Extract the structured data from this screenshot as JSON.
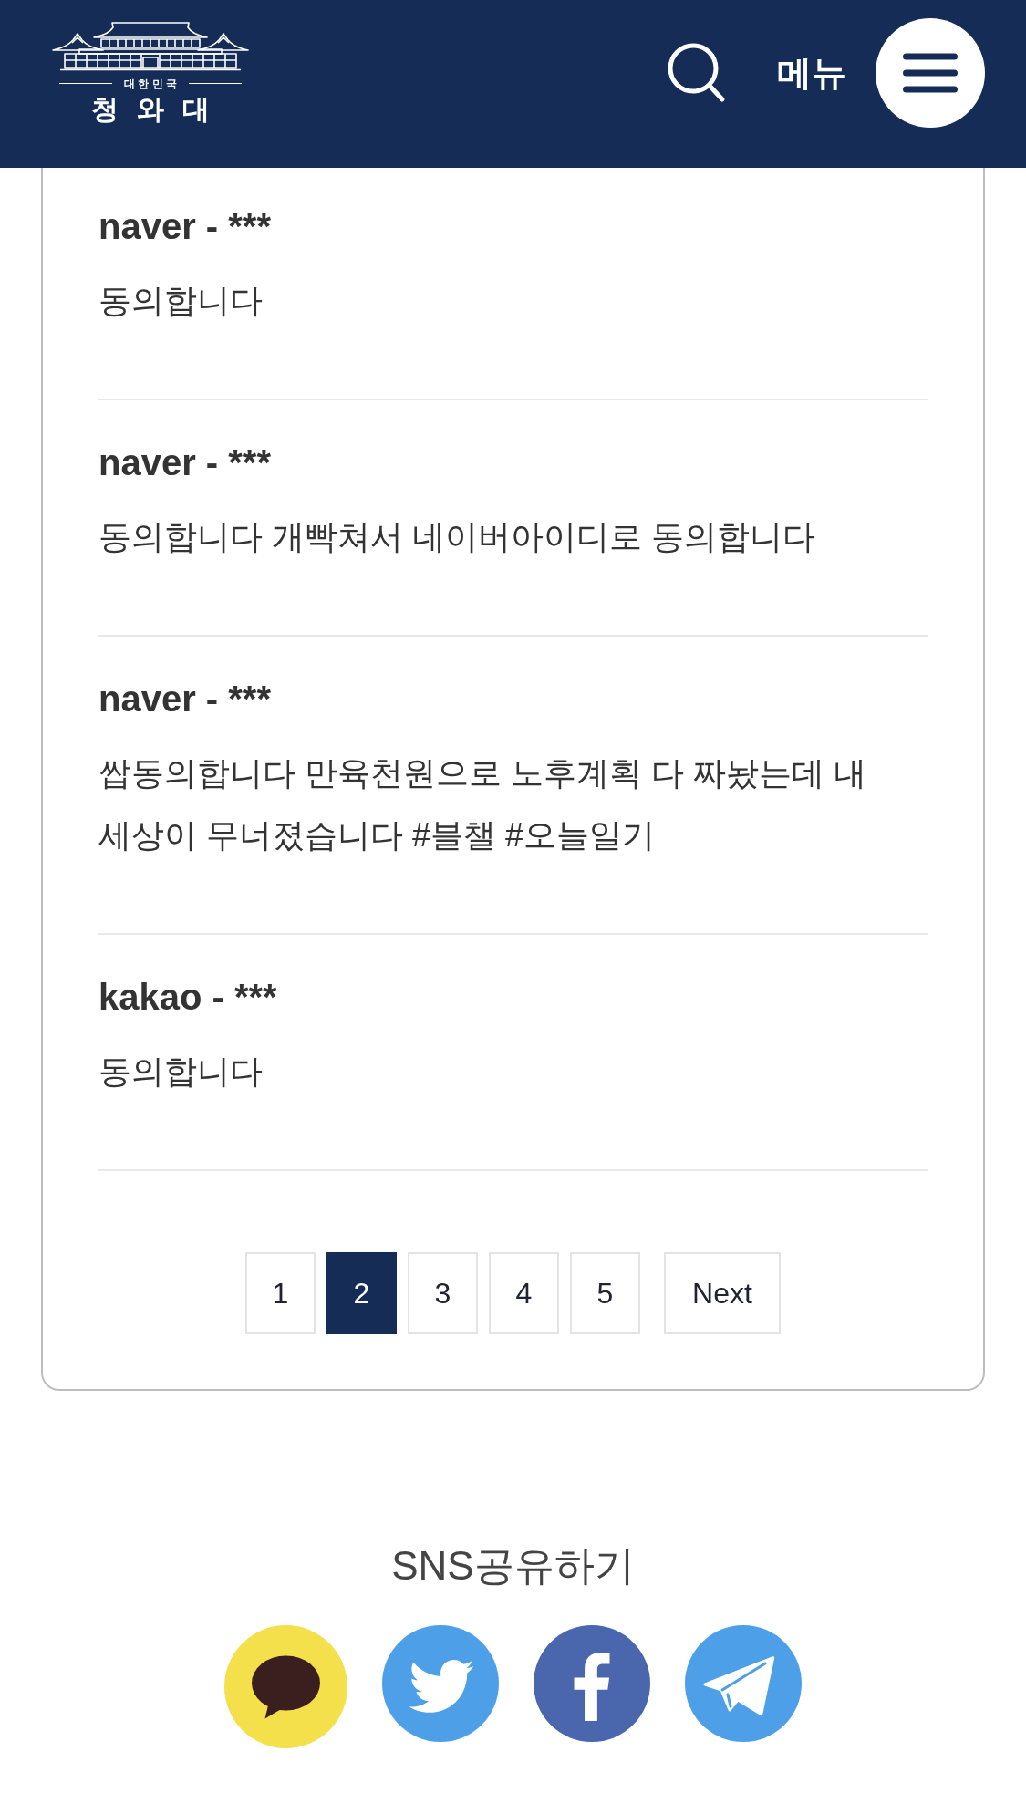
{
  "header": {
    "logo": {
      "subtitle": "대한민국",
      "title": "청 와 대"
    },
    "menu_label": "메뉴"
  },
  "comments": [
    {
      "author": "naver - ***",
      "text": "동의합니다"
    },
    {
      "author": "naver - ***",
      "text": "동의합니다 개빡쳐서 네이버아이디로 동의합니다"
    },
    {
      "author": "naver - ***",
      "text": "쌉동의합니다 만육천원으로 노후계획 다 짜놨는데 내 세상이 무너졌습니다 #블챌 #오늘일기"
    },
    {
      "author": "kakao - ***",
      "text": "동의합니다"
    }
  ],
  "pagination": {
    "pages": [
      {
        "label": "1",
        "selected": false
      },
      {
        "label": "2",
        "selected": true
      },
      {
        "label": "3",
        "selected": false
      },
      {
        "label": "4",
        "selected": false
      },
      {
        "label": "5",
        "selected": false
      }
    ],
    "next": "Next"
  },
  "share": {
    "title": "SNS공유하기"
  }
}
